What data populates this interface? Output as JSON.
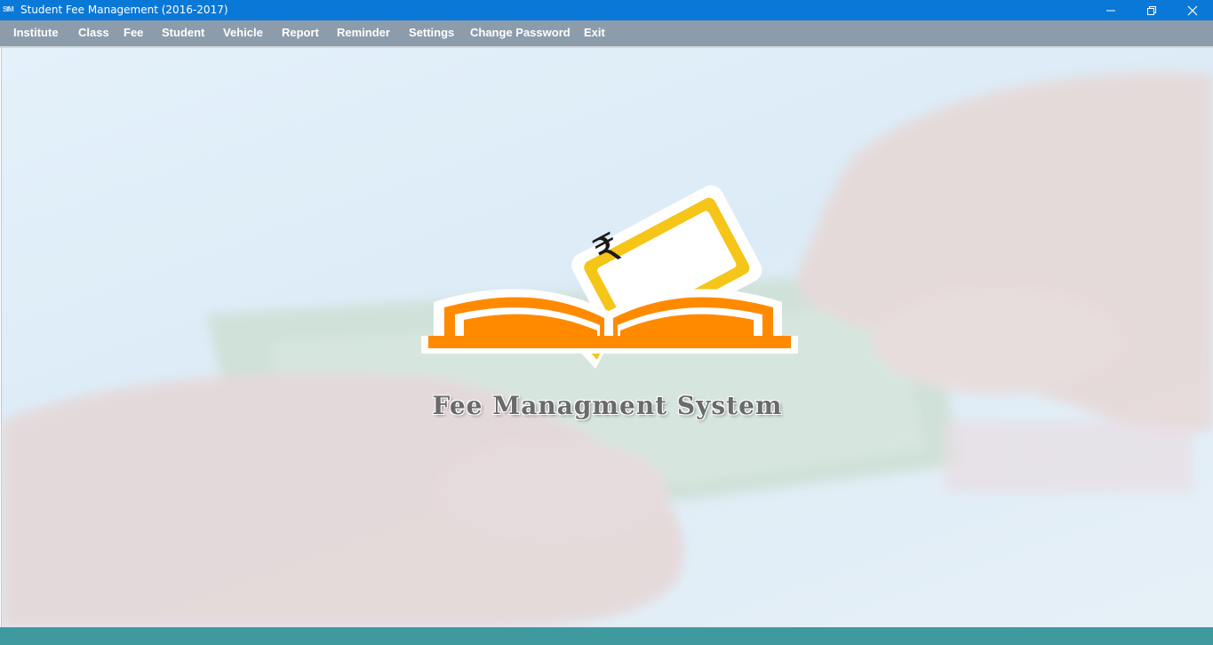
{
  "window": {
    "title": "Student Fee Management (2016-2017)",
    "icon": "app-icon",
    "controls": [
      "minimize-icon",
      "restore-icon",
      "close-icon"
    ]
  },
  "menu": {
    "items": [
      {
        "label": "Institute"
      },
      {
        "label": "Class"
      },
      {
        "label": "Fee"
      },
      {
        "label": "Student"
      },
      {
        "label": "Vehicle"
      },
      {
        "label": "Report"
      },
      {
        "label": "Reminder"
      },
      {
        "label": "Settings"
      },
      {
        "label": "Change Password"
      },
      {
        "label": "Exit"
      }
    ]
  },
  "main": {
    "logo_title": "Fee Managment System",
    "logo_symbol": "₹",
    "colors": {
      "orange": "#ff8a00",
      "yellow": "#f5c518",
      "titlebar": "#0a78d7",
      "menubar": "#8d9cab",
      "statusbar": "#3f9aa0"
    }
  }
}
